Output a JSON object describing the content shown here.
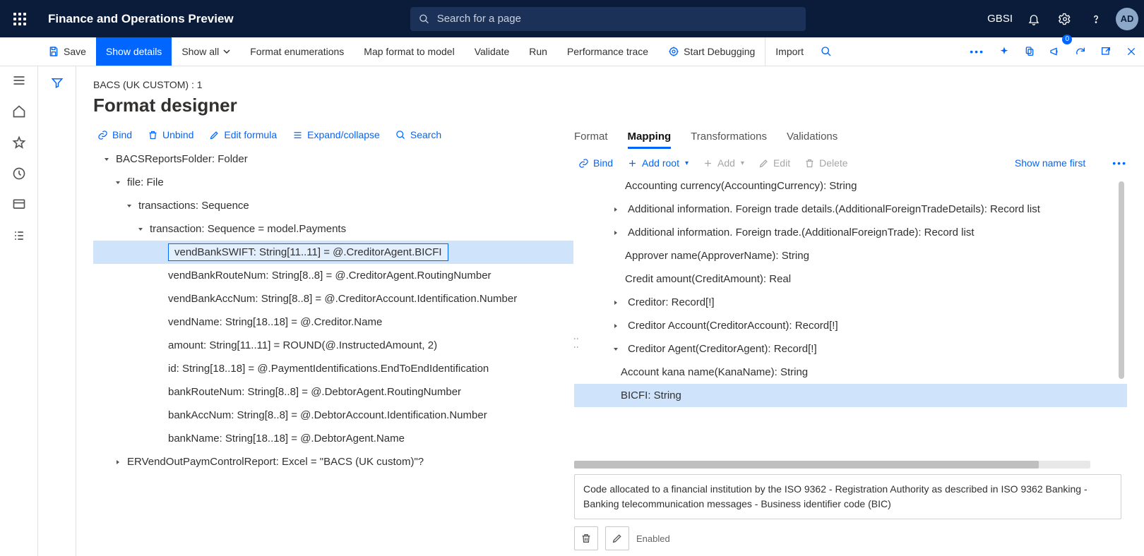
{
  "header": {
    "appTitle": "Finance and Operations Preview",
    "searchPlaceholder": "Search for a page",
    "company": "GBSI",
    "avatar": "AD"
  },
  "commandbar": {
    "save": "Save",
    "showDetails": "Show details",
    "showAll": "Show all",
    "formatEnum": "Format enumerations",
    "mapFormat": "Map format to model",
    "validate": "Validate",
    "run": "Run",
    "perfTrace": "Performance trace",
    "startDebug": "Start Debugging",
    "import": "Import",
    "feedbackBadge": "0"
  },
  "page": {
    "breadcrumb": "BACS (UK CUSTOM) : 1",
    "title": "Format designer"
  },
  "leftToolbar": {
    "bind": "Bind",
    "unbind": "Unbind",
    "editFormula": "Edit formula",
    "expandCollapse": "Expand/collapse",
    "search": "Search"
  },
  "tree": [
    {
      "lvl": 0,
      "arrow": "down",
      "label": "BACSReportsFolder: Folder"
    },
    {
      "lvl": 1,
      "arrow": "down",
      "label": "file: File"
    },
    {
      "lvl": 2,
      "arrow": "down",
      "label": "transactions: Sequence"
    },
    {
      "lvl": 3,
      "arrow": "down",
      "label": "transaction: Sequence = model.Payments"
    },
    {
      "lvl": 4,
      "arrow": "none",
      "sel": true,
      "label": "vendBankSWIFT: String[11..11] = @.CreditorAgent.BICFI"
    },
    {
      "lvl": 4,
      "arrow": "none",
      "label": "vendBankRouteNum: String[8..8] = @.CreditorAgent.RoutingNumber"
    },
    {
      "lvl": 4,
      "arrow": "none",
      "label": "vendBankAccNum: String[8..8] = @.CreditorAccount.Identification.Number"
    },
    {
      "lvl": 4,
      "arrow": "none",
      "label": "vendName: String[18..18] = @.Creditor.Name"
    },
    {
      "lvl": 4,
      "arrow": "none",
      "label": "amount: String[11..11] = ROUND(@.InstructedAmount, 2)"
    },
    {
      "lvl": 4,
      "arrow": "none",
      "label": "id: String[18..18] = @.PaymentIdentifications.EndToEndIdentification"
    },
    {
      "lvl": 4,
      "arrow": "none",
      "label": "bankRouteNum: String[8..8] = @.DebtorAgent.RoutingNumber"
    },
    {
      "lvl": 4,
      "arrow": "none",
      "label": "bankAccNum: String[8..8] = @.DebtorAccount.Identification.Number"
    },
    {
      "lvl": 4,
      "arrow": "none",
      "label": "bankName: String[18..18] = @.DebtorAgent.Name"
    },
    {
      "lvl": 1,
      "arrow": "right",
      "label": "ERVendOutPaymControlReport: Excel = \"BACS (UK custom)\"?"
    }
  ],
  "tabs": {
    "format": "Format",
    "mapping": "Mapping",
    "transformations": "Transformations",
    "validations": "Validations"
  },
  "mapToolbar": {
    "bind": "Bind",
    "addRoot": "Add root",
    "add": "Add",
    "edit": "Edit",
    "delete": "Delete",
    "showNameFirst": "Show name first"
  },
  "mapTree": [
    {
      "lvl": 0,
      "arrow": "none",
      "label": "Accounting currency(AccountingCurrency): String"
    },
    {
      "lvl": 0,
      "arrow": "right",
      "label": "Additional information. Foreign trade details.(AdditionalForeignTradeDetails): Record list"
    },
    {
      "lvl": 0,
      "arrow": "right",
      "label": "Additional information. Foreign trade.(AdditionalForeignTrade): Record list"
    },
    {
      "lvl": 0,
      "arrow": "none",
      "label": "Approver name(ApproverName): String"
    },
    {
      "lvl": 0,
      "arrow": "none",
      "label": "Credit amount(CreditAmount): Real"
    },
    {
      "lvl": 0,
      "arrow": "right",
      "label": "Creditor: Record[!]"
    },
    {
      "lvl": 0,
      "arrow": "right",
      "label": "Creditor Account(CreditorAccount): Record[!]"
    },
    {
      "lvl": 0,
      "arrow": "down",
      "label": "Creditor Agent(CreditorAgent): Record[!]"
    },
    {
      "lvl": 1,
      "arrow": "none",
      "label": "Account kana name(KanaName): String"
    },
    {
      "lvl": 1,
      "arrow": "none",
      "sel": true,
      "label": "BICFI: String"
    }
  ],
  "description": "Code allocated to a financial institution by the ISO 9362 - Registration Authority as described in ISO 9362 Banking - Banking telecommunication messages - Business identifier code (BIC)",
  "enabledLabel": "Enabled"
}
